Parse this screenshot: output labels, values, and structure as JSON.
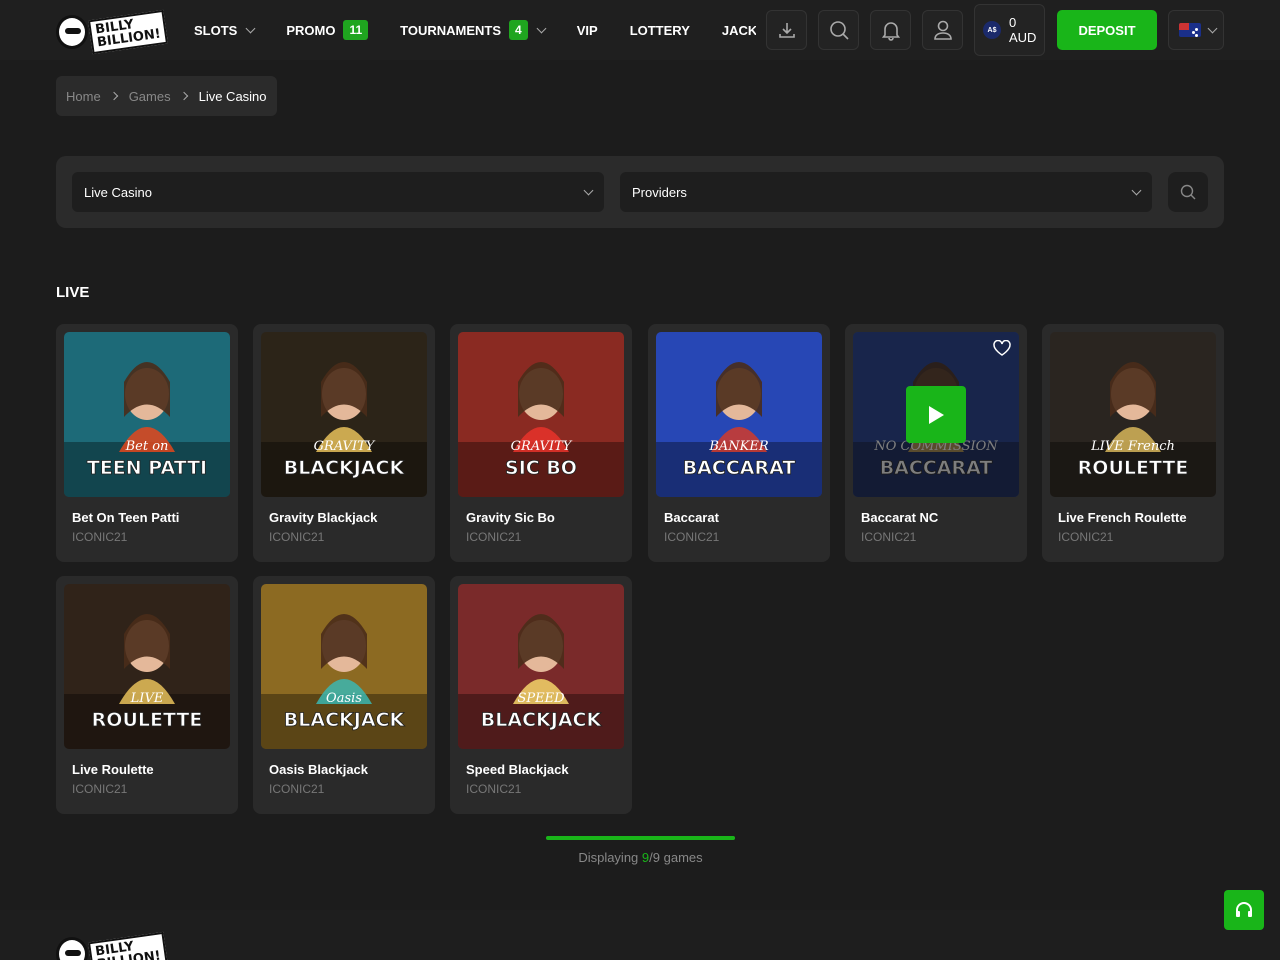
{
  "header": {
    "logo_lines": [
      "BILLY",
      "BILLION!"
    ],
    "nav": [
      {
        "label": "SLOTS",
        "badge": "",
        "dropdown": true
      },
      {
        "label": "PROMO",
        "badge": "11",
        "dropdown": false
      },
      {
        "label": "TOURNAMENTS",
        "badge": "4",
        "dropdown": true
      },
      {
        "label": "VIP",
        "badge": "",
        "dropdown": false
      },
      {
        "label": "LOTTERY",
        "badge": "",
        "dropdown": false
      },
      {
        "label": "JACKPC",
        "badge": "",
        "dropdown": false
      }
    ],
    "wallet": {
      "currency_badge": "A$",
      "balance": "0",
      "currency": "AUD"
    },
    "deposit_label": "DEPOSIT",
    "language_flag": "australia-flag-icon"
  },
  "breadcrumb": {
    "items": [
      "Home",
      "Games"
    ],
    "current": "Live Casino"
  },
  "filters": {
    "category": "Live Casino",
    "providers": "Providers"
  },
  "section_title": "LIVE",
  "games": [
    {
      "title": "Bet On Teen Patti",
      "provider": "ICONIC21",
      "art_top": "Bet on",
      "art_main": "TEEN PATTI",
      "bg": "#1d6a78",
      "accent": "#e3461c"
    },
    {
      "title": "Gravity Blackjack",
      "provider": "ICONIC21",
      "art_top": "GRAVITY",
      "art_main": "BLACKJACK",
      "bg": "#2c2418",
      "accent": "#e8c15a"
    },
    {
      "title": "Gravity Sic Bo",
      "provider": "ICONIC21",
      "art_top": "GRAVITY",
      "art_main": "SIC BO",
      "bg": "#8a2a22",
      "accent": "#e8332a"
    },
    {
      "title": "Baccarat",
      "provider": "ICONIC21",
      "art_top": "BANKER",
      "art_main": "BACCARAT",
      "bg": "#2747b5",
      "accent": "#d23b2a"
    },
    {
      "title": "Baccarat NC",
      "provider": "ICONIC21",
      "art_top": "NO COMMISSION",
      "art_main": "BACCARAT",
      "bg": "#1e3a8e",
      "accent": "#c9a14a"
    },
    {
      "title": "Live French Roulette",
      "provider": "ICONIC21",
      "art_top": "LIVE French",
      "art_main": "ROULETTE",
      "bg": "#2a2520",
      "accent": "#d7b65a"
    },
    {
      "title": "Live Roulette",
      "provider": "ICONIC21",
      "art_top": "LIVE",
      "art_main": "ROULETTE",
      "bg": "#302319",
      "accent": "#e8c15a"
    },
    {
      "title": "Oasis Blackjack",
      "provider": "ICONIC21",
      "art_top": "Oasis",
      "art_main": "BLACKJACK",
      "bg": "#8c6a22",
      "accent": "#3bb6b0"
    },
    {
      "title": "Speed Blackjack",
      "provider": "ICONIC21",
      "art_top": "SPEED",
      "art_main": "BLACKJACK",
      "bg": "#7a2a2a",
      "accent": "#f5d56a"
    }
  ],
  "hovered_game_index": 4,
  "progress": {
    "prefix": "Displaying",
    "shown": "9",
    "separator": "/",
    "total": "9",
    "suffix": "games",
    "fraction": 1.0
  },
  "footer": {
    "logo_lines": [
      "BILLY",
      "BILLION!"
    ]
  },
  "colors": {
    "accent": "#19b519",
    "background": "#1c1c1c",
    "card": "#2a2a2a"
  }
}
